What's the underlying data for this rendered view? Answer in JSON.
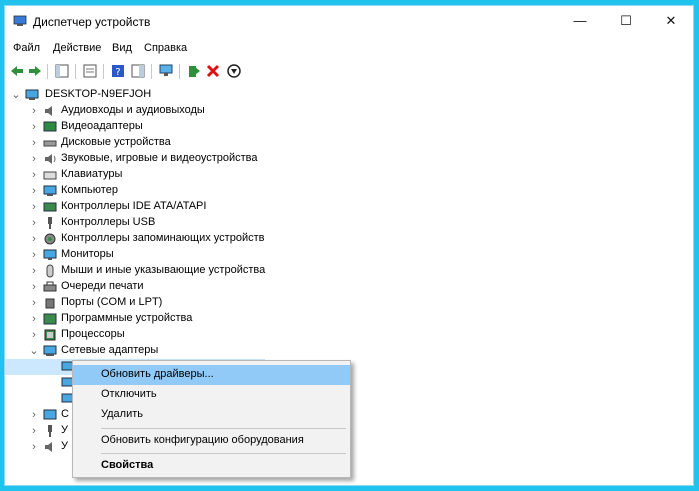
{
  "window": {
    "title": "Диспетчер устройств",
    "minimize": "—",
    "maximize": "☐",
    "close": "✕"
  },
  "menu": [
    "Файл",
    "Действие",
    "Вид",
    "Справка"
  ],
  "tree": {
    "root": "DESKTOP-N9EFJOH",
    "categories": [
      "Аудиовходы и аудиовыходы",
      "Видеоадаптеры",
      "Дисковые устройства",
      "Звуковые, игровые и видеоустройства",
      "Клавиатуры",
      "Компьютер",
      "Контроллеры IDE ATA/ATAPI",
      "Контроллеры USB",
      "Контроллеры запоминающих устройств",
      "Мониторы",
      "Мыши и иные указывающие устройства",
      "Очереди печати",
      "Порты (COM и LPT)",
      "Программные устройства",
      "Процессоры",
      "Сетевые адаптеры"
    ],
    "partial": [
      "С",
      "У",
      "У"
    ]
  },
  "context_menu": {
    "update": "Обновить драйверы...",
    "disable": "Отключить",
    "delete": "Удалить",
    "scan": "Обновить конфигурацию оборудования",
    "properties": "Свойства"
  },
  "colors": {
    "background": "#1fc3ee",
    "highlight": "#91c9f7",
    "menu_bg": "#f2f2f2"
  },
  "icons": [
    "back-arrow-icon",
    "forward-arrow-icon",
    "properties-icon",
    "help-icon",
    "scan-icon",
    "update-driver-icon",
    "remove-device-icon",
    "disable-device-icon"
  ]
}
